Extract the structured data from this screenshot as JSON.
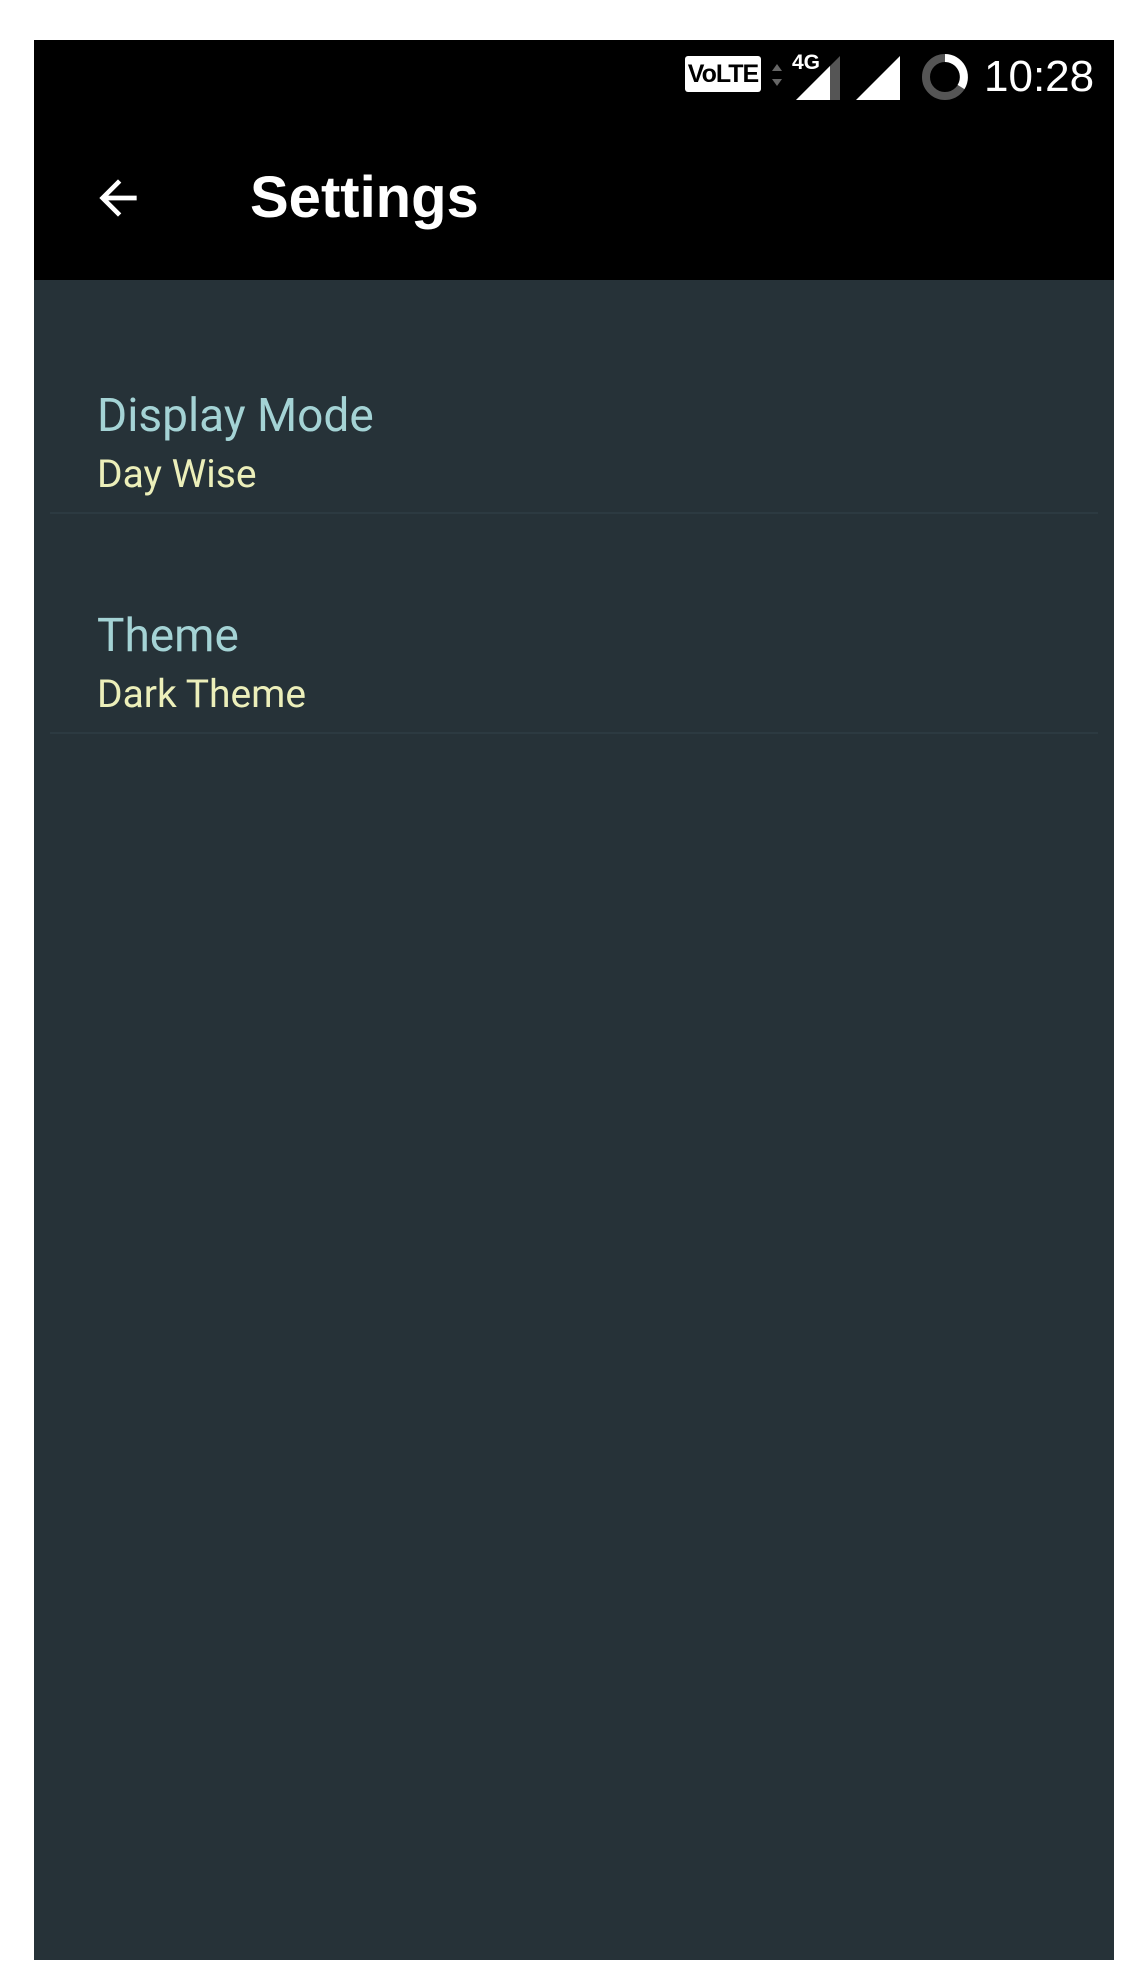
{
  "status_bar": {
    "volte_label": "VoLTE",
    "network_type": "4G",
    "time": "10:28",
    "icons": [
      "volte-icon",
      "data-activity-icon",
      "signal-4g-icon",
      "signal-icon",
      "battery-icon"
    ]
  },
  "toolbar": {
    "back_icon": "arrow-back-icon",
    "title": "Settings"
  },
  "preferences": [
    {
      "title": "Display Mode",
      "summary": "Day Wise"
    },
    {
      "title": "Theme",
      "summary": "Dark Theme"
    }
  ],
  "colors": {
    "background": "#263238",
    "toolbar": "#000000",
    "pref_title": "#a4d3d5",
    "pref_summary": "#ecefba",
    "divider": "#2c3a41"
  }
}
